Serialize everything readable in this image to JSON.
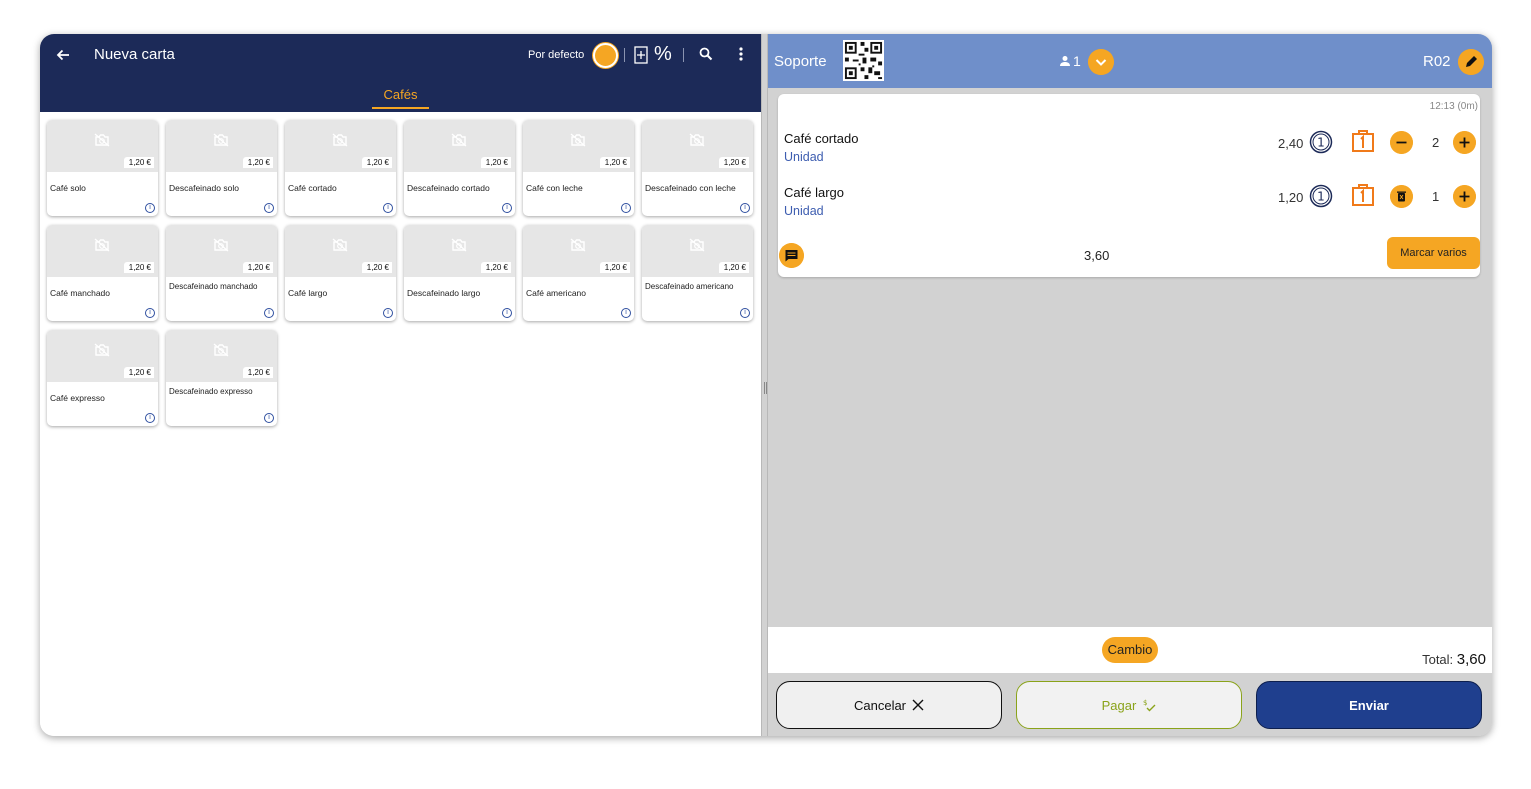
{
  "left": {
    "title": "Nueva carta",
    "defecto": "Por defecto",
    "percent": "%",
    "tab": "Cafés",
    "products": [
      {
        "name": "Café solo",
        "price": "1,20 €"
      },
      {
        "name": "Descafeinado solo",
        "price": "1,20 €"
      },
      {
        "name": "Café cortado",
        "price": "1,20 €"
      },
      {
        "name": "Descafeinado cortado",
        "price": "1,20 €"
      },
      {
        "name": "Café con leche",
        "price": "1,20 €"
      },
      {
        "name": "Descafeinado con leche",
        "price": "1,20 €"
      },
      {
        "name": "Café manchado",
        "price": "1,20 €"
      },
      {
        "name": "Descafeinado manchado",
        "price": "1,20 €"
      },
      {
        "name": "Café largo",
        "price": "1,20 €"
      },
      {
        "name": "Descafeinado largo",
        "price": "1,20 €"
      },
      {
        "name": "Café americano",
        "price": "1,20 €"
      },
      {
        "name": "Descafeinado americano",
        "price": "1,20 €"
      },
      {
        "name": "Café expresso",
        "price": "1,20 €"
      },
      {
        "name": "Descafeinado expresso",
        "price": "1,20 €"
      }
    ]
  },
  "right": {
    "soporte": "Soporte",
    "people": "1",
    "table": "R02",
    "time": "12:13 (0m)",
    "lines": [
      {
        "name": "Café cortado",
        "unit": "Unidad",
        "price": "2,40",
        "course": "1",
        "qty": "2"
      },
      {
        "name": "Café largo",
        "unit": "Unidad",
        "price": "1,20",
        "course": "1",
        "qty": "1"
      }
    ],
    "subtotal": "3,60",
    "marcar": "Marcar varios",
    "cambio": "Cambio",
    "total_label": "Total:",
    "total_value": "3,60",
    "cancelar": "Cancelar",
    "pagar": "Pagar",
    "enviar": "Enviar"
  },
  "colors": {
    "navy": "#1c2a58",
    "accent": "#f5a623",
    "header_blue": "#6f8fca",
    "send_blue": "#1f3f8e",
    "pay_green": "#8aa31a"
  }
}
